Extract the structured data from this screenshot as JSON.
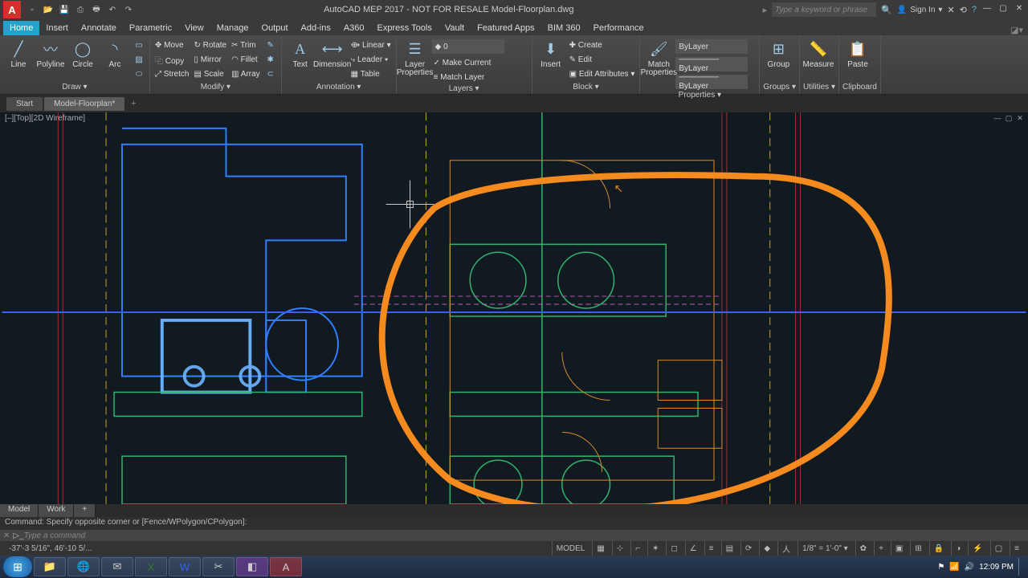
{
  "title": "AutoCAD MEP 2017 - NOT FOR RESALE   Model-Floorplan.dwg",
  "search_placeholder": "Type a keyword or phrase",
  "signin": "Sign In",
  "ribbon_tabs": [
    "Home",
    "Insert",
    "Annotate",
    "Parametric",
    "View",
    "Manage",
    "Output",
    "Add-ins",
    "A360",
    "Express Tools",
    "Vault",
    "Featured Apps",
    "BIM 360",
    "Performance"
  ],
  "active_ribbon_tab": "Home",
  "panels": {
    "draw": {
      "title": "Draw ▾",
      "buttons": [
        "Line",
        "Polyline",
        "Circle",
        "Arc"
      ]
    },
    "modify": {
      "title": "Modify ▾",
      "rows": [
        [
          "✥ Move",
          "↻ Rotate",
          "✂ Trim",
          "…"
        ],
        [
          "⿻ Copy",
          "▯ Mirror",
          "◠ Fillet",
          "…"
        ],
        [
          "⤢ Stretch",
          "▤ Scale",
          "▥ Array",
          "…"
        ]
      ]
    },
    "annotation": {
      "title": "Annotation ▾",
      "text": "Text",
      "dim": "Dimension",
      "rows": [
        "⟴ Linear ▾",
        "⤷ Leader ▾",
        "▦ Table"
      ]
    },
    "layers": {
      "title": "Layers ▾",
      "lp": "Layer\nProperties",
      "mc": "✓ Make Current",
      "ml": "≡ Match Layer"
    },
    "block": {
      "title": "Block ▾",
      "ins": "Insert",
      "rows": [
        "✚ Create",
        "✎ Edit",
        "▣ Edit Attributes ▾"
      ]
    },
    "properties": {
      "title": "Properties ▾",
      "mp": "Match\nProperties",
      "sel": "ByLayer",
      "row1": "─────── ByLayer",
      "row2": "─────── ByLayer"
    },
    "groups": {
      "title": "Groups ▾",
      "g": "Group"
    },
    "utilities": {
      "title": "Utilities ▾",
      "m": "Measure"
    },
    "clipboard": {
      "title": "Clipboard",
      "p": "Paste"
    }
  },
  "file_tabs": [
    "Start",
    "Model-Floorplan*"
  ],
  "view_label": "[‒][Top][2D Wireframe]",
  "cmd_history": "Command: Specify opposite corner or [Fence/WPolygon/CPolygon]:",
  "cmd_placeholder": "Type a command",
  "model_tabs": [
    "Model",
    "Work",
    "+"
  ],
  "status": {
    "coords": "-37'-3 5/16\", 46'-10 5/...",
    "mode": "MODEL",
    "scale": "1/8\" = 1'-0\" ▾"
  },
  "taskbar_time": "12:09 PM"
}
